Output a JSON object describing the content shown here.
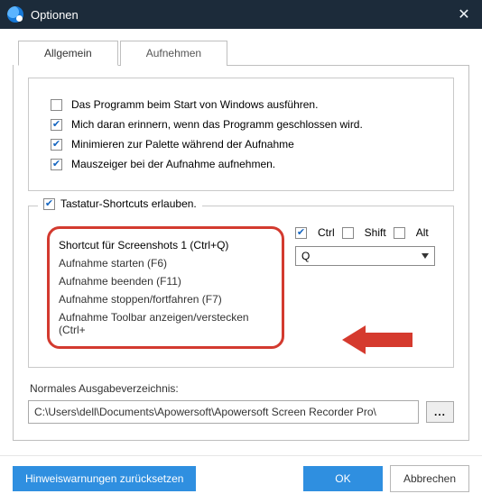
{
  "window": {
    "title": "Optionen"
  },
  "tabs": {
    "general": "Allgemein",
    "recording": "Aufnehmen"
  },
  "options": {
    "run_on_start": "Das Programm beim Start von Windows ausführen.",
    "remind_close": "Mich daran erinnern, wenn das Programm geschlossen wird.",
    "minimize_palette": "Minimieren zur Palette während der Aufnahme",
    "capture_cursor": "Mauszeiger bei der Aufnahme aufnehmen."
  },
  "shortcuts": {
    "legend": "Tastatur-Shortcuts erlauben.",
    "items": [
      "Shortcut für Screenshots 1 (Ctrl+Q)",
      "Aufnahme starten (F6)",
      "Aufnahme beenden (F11)",
      "Aufnahme stoppen/fortfahren (F7)",
      "Aufnahme Toolbar anzeigen/verstecken (Ctrl+"
    ],
    "mods": {
      "ctrl": "Ctrl",
      "shift": "Shift",
      "alt": "Alt"
    },
    "key": "Q"
  },
  "output": {
    "label": "Normales Ausgabeverzeichnis:",
    "path": "C:\\Users\\dell\\Documents\\Apowersoft\\Apowersoft Screen Recorder Pro\\",
    "browse": "..."
  },
  "footer": {
    "reset": "Hinweiswarnungen zurücksetzen",
    "ok": "OK",
    "cancel": "Abbrechen"
  }
}
